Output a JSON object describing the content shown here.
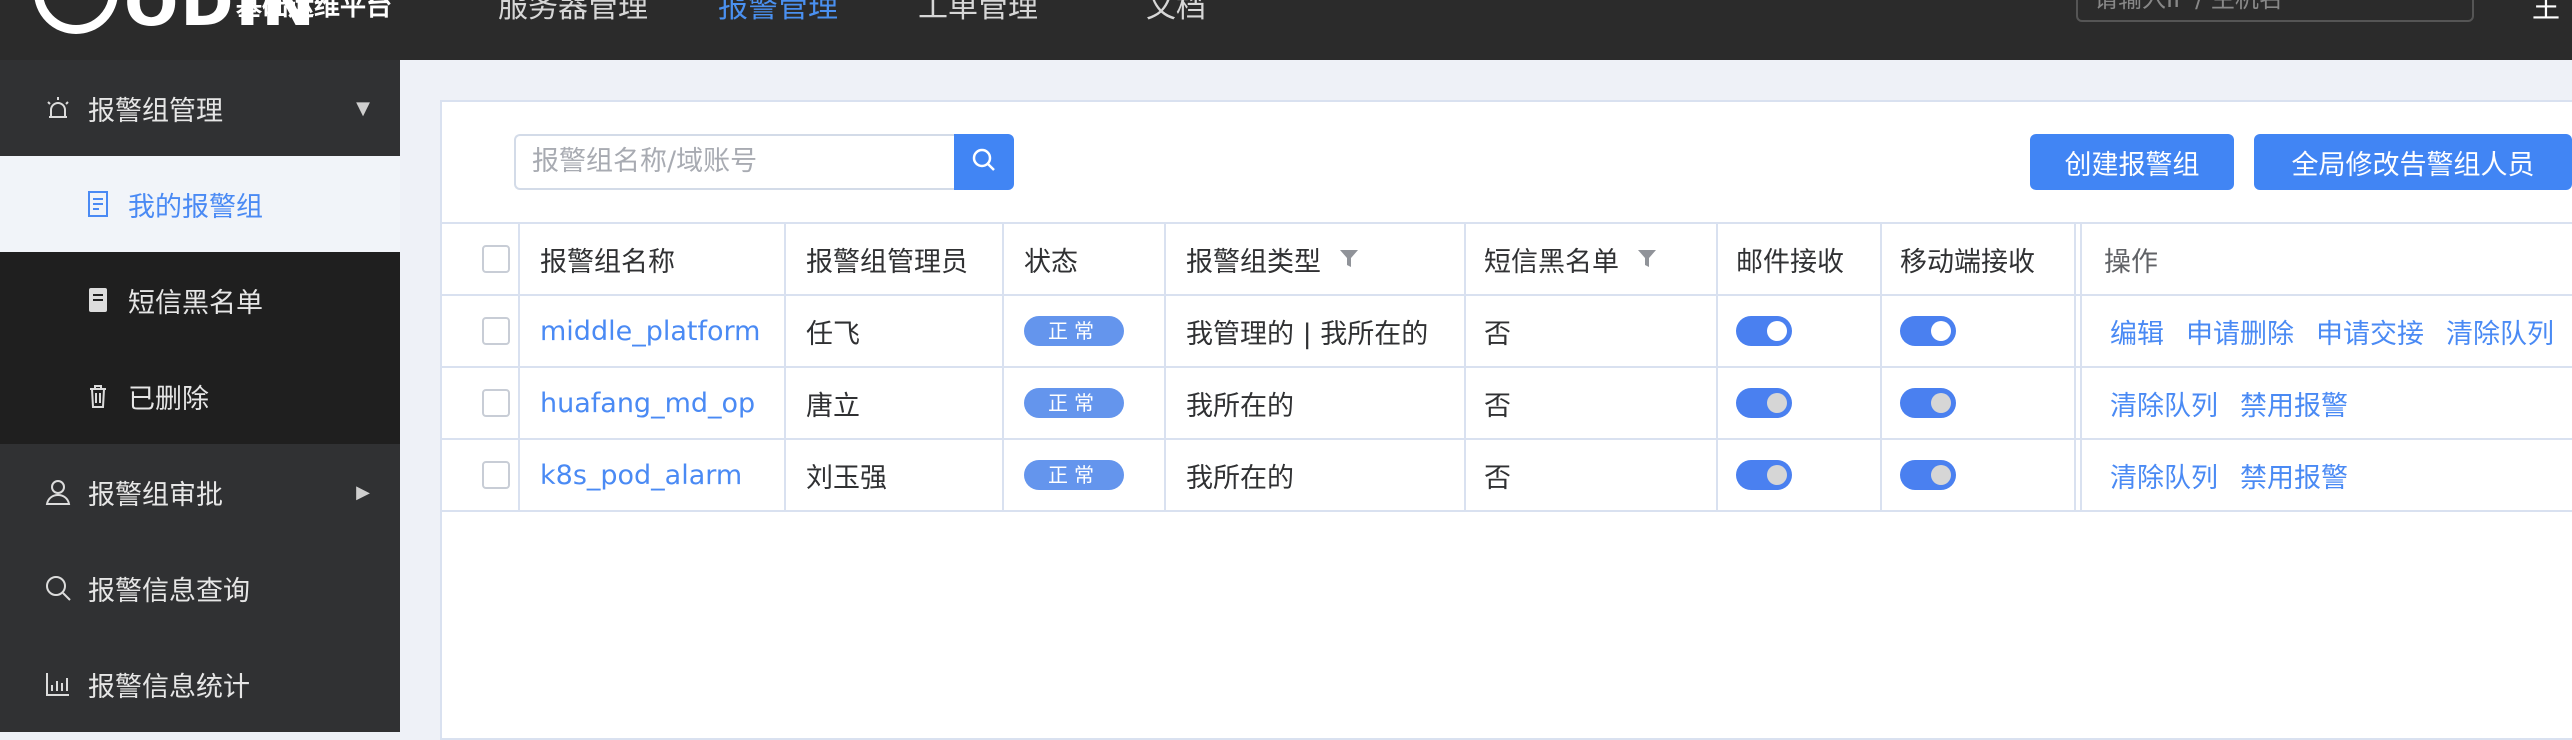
{
  "app": {
    "logo_text": "ODIN",
    "subtitle": "基础运维平台",
    "nav": [
      "服务器管理",
      "报警管理",
      "工单管理",
      "文档"
    ],
    "active_nav": "报警管理",
    "search_placeholder": "请输入IP / 主机名",
    "user_initial": "王"
  },
  "sidebar": {
    "group1": {
      "label": "报警组管理",
      "icon": "alarm-icon"
    },
    "sub_items": [
      {
        "label": "我的报警组",
        "icon": "document-icon",
        "active": true
      },
      {
        "label": "短信黑名单",
        "icon": "notebook-icon",
        "active": false
      },
      {
        "label": "已删除",
        "icon": "trash-icon",
        "active": false
      }
    ],
    "group2": {
      "label": "报警组审批",
      "icon": "user-icon"
    },
    "group3": {
      "label": "报警信息查询",
      "icon": "search-icon"
    },
    "group4": {
      "label": "报警信息统计",
      "icon": "chart-icon"
    }
  },
  "toolbar": {
    "search_placeholder": "报警组名称/域账号",
    "create_button": "创建报警组",
    "global_edit_button": "全局修改告警组人员"
  },
  "table": {
    "headers": {
      "name": "报警组名称",
      "admin": "报警组管理员",
      "status": "状态",
      "type": "报警组类型",
      "sms_blacklist": "短信黑名单",
      "email": "邮件接收",
      "mobile": "移动端接收",
      "actions": "操作"
    },
    "rows": [
      {
        "name": "middle_platform",
        "admin": "任飞",
        "status": "正常",
        "type": "我管理的 | 我所在的",
        "sms_blacklist": "否",
        "email_on": true,
        "mobile_on": true,
        "actions": [
          "编辑",
          "申请删除",
          "申请交接",
          "清除队列"
        ]
      },
      {
        "name": "huafang_md_op",
        "admin": "唐立",
        "status": "正常",
        "type": "我所在的",
        "sms_blacklist": "否",
        "email_on": false,
        "mobile_on": false,
        "actions": [
          "清除队列",
          "禁用报警"
        ]
      },
      {
        "name": "k8s_pod_alarm",
        "admin": "刘玉强",
        "status": "正常",
        "type": "我所在的",
        "sms_blacklist": "否",
        "email_on": false,
        "mobile_on": false,
        "actions": [
          "清除队列",
          "禁用报警"
        ]
      }
    ]
  },
  "colors": {
    "accent": "#4185f4",
    "sidebar_bg": "#303133",
    "topbar_bg": "#2b2b2b",
    "badge": "#6495ed"
  }
}
